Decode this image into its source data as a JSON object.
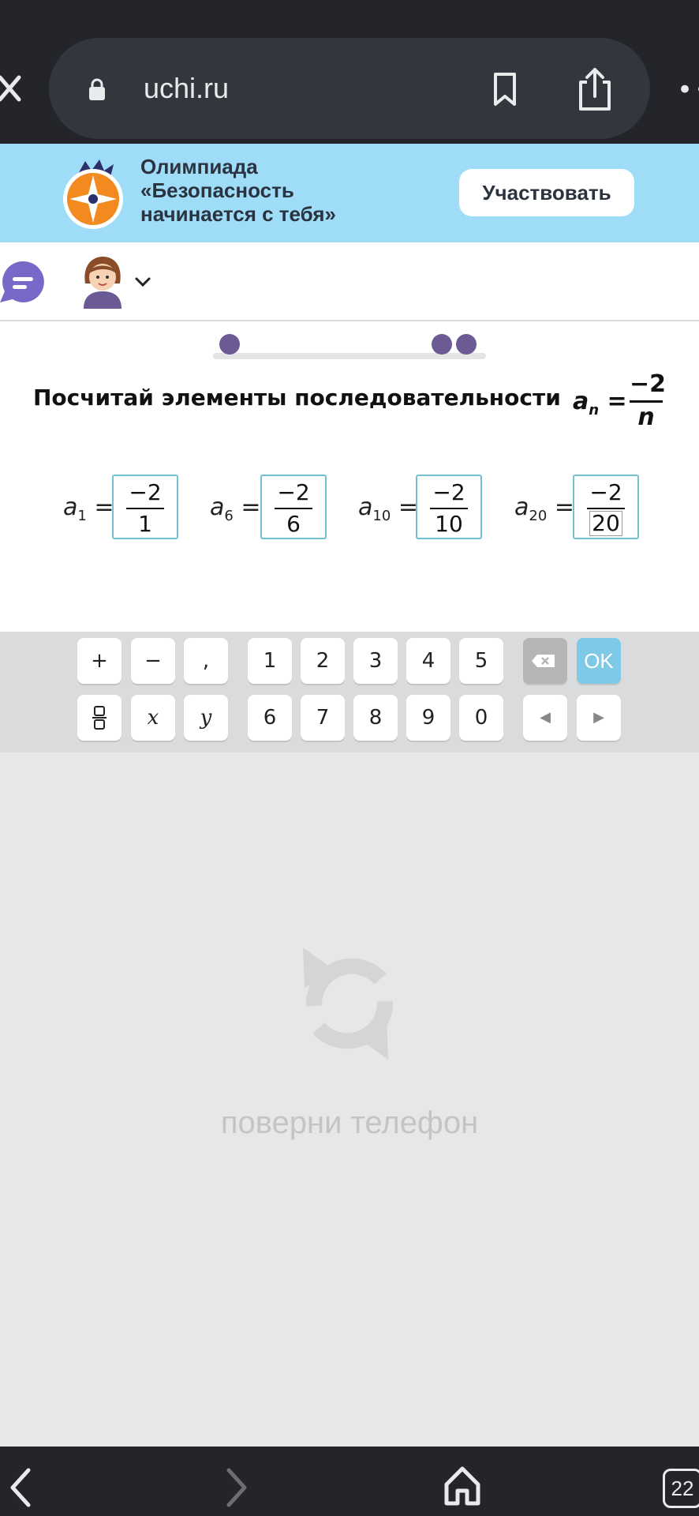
{
  "browser": {
    "url": "uchi.ru",
    "tab_count": "22"
  },
  "banner": {
    "line1": "Олимпиада",
    "line2": "«Безопасность",
    "line3": "начинается с тебя»",
    "button": "Участвовать"
  },
  "task": {
    "title": "Посчитай элементы последовательности",
    "formula": {
      "var": "a",
      "sub": "n",
      "numerator": "−2",
      "denominator": "n"
    },
    "terms": [
      {
        "var": "a",
        "sub": "1",
        "numerator": "−2",
        "denominator": "1"
      },
      {
        "var": "a",
        "sub": "6",
        "numerator": "−2",
        "denominator": "6"
      },
      {
        "var": "a",
        "sub": "10",
        "numerator": "−2",
        "denominator": "10"
      },
      {
        "var": "a",
        "sub": "20",
        "numerator": "−2",
        "denominator": "20"
      }
    ]
  },
  "keyboard": {
    "row1": [
      "+",
      "−",
      ",",
      "1",
      "2",
      "3",
      "4",
      "5",
      "",
      "OK"
    ],
    "row2": [
      "",
      "x",
      "y",
      "6",
      "7",
      "8",
      "9",
      "0",
      "◀",
      "▶"
    ]
  },
  "rotate_notice": "поверни телефон",
  "colors": {
    "accent_purple": "#6b5a93",
    "banner_blue": "#9fdcf7",
    "box_border": "#6fc0d3",
    "ok_blue": "#7ec9e6"
  }
}
